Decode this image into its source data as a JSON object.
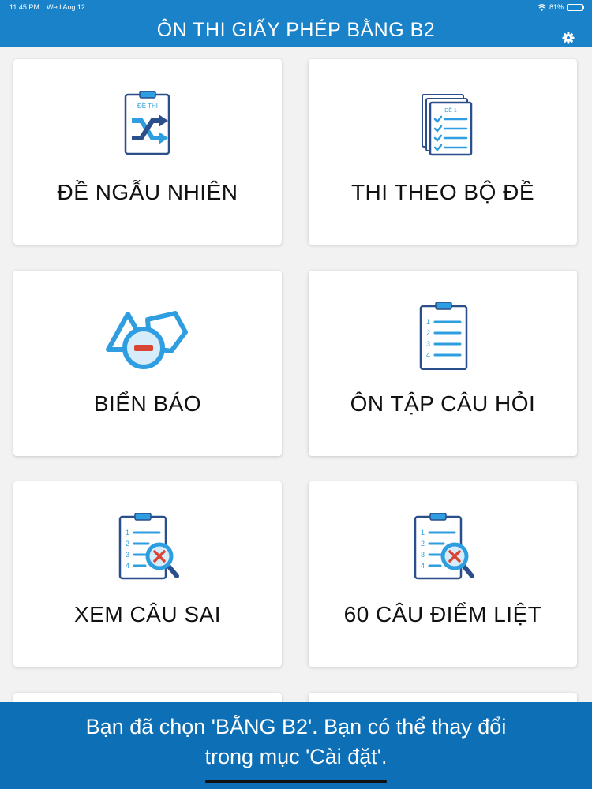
{
  "status_bar": {
    "time": "11:45 PM",
    "date": "Wed Aug 12",
    "battery_text": "81%",
    "battery_level": 0.81
  },
  "header": {
    "title": "ÔN THI GIẤY PHÉP BẰNG B2"
  },
  "menu": [
    {
      "label": "ĐỀ NGẪU NHIÊN",
      "icon_text": "ĐỀ THI",
      "icon": "shuffle-clipboard-icon"
    },
    {
      "label": "THI THEO BỘ ĐỀ",
      "icon_text": "ĐỀ 1",
      "icon": "stacked-papers-icon"
    },
    {
      "label": "BIỂN BÁO",
      "icon": "traffic-signs-icon"
    },
    {
      "label": "ÔN TẬP CÂU HỎI",
      "icon": "numbered-clipboard-icon"
    },
    {
      "label": "XEM CÂU SAI",
      "icon": "clipboard-magnifier-icon"
    },
    {
      "label": "60 CÂU ĐIỂM LIỆT",
      "icon": "clipboard-magnifier-icon"
    }
  ],
  "numbers": [
    "1",
    "2",
    "3",
    "4"
  ],
  "banner": {
    "line1": "Bạn đã chọn 'BẰNG B2'. Bạn có thể thay đổi",
    "line2": "trong mục 'Cài đặt'."
  },
  "colors": {
    "header": "#1a82c8",
    "banner": "#0d6fb6",
    "icon_blue": "#2e9ee0",
    "icon_dark": "#2b4f8a",
    "icon_red": "#d94535"
  }
}
